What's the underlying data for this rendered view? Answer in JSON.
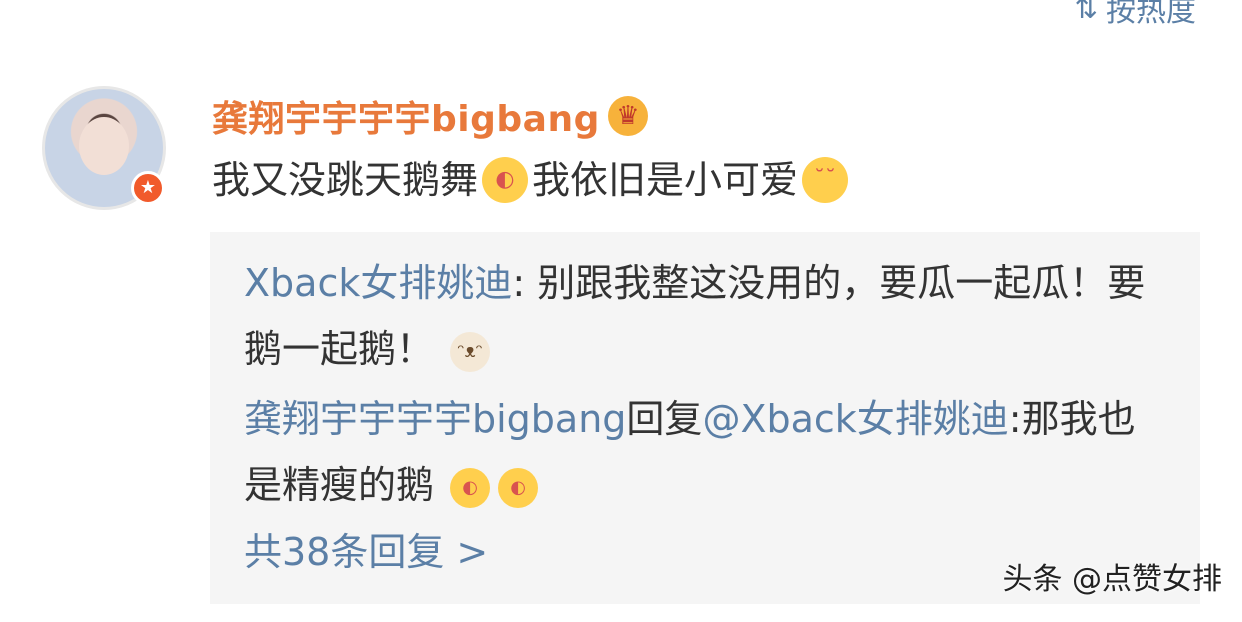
{
  "sort": {
    "label": "按热度",
    "icon": "sort-icon"
  },
  "comment": {
    "username": "龚翔宇宇宇宇bigbang",
    "crown_icon": "crown-icon",
    "text_part1": "我又没跳天鹅舞",
    "text_part2": "我依旧是小可爱",
    "emoji1": "watermelon-emoji",
    "emoji2": "blush-emoji"
  },
  "replies": [
    {
      "author": "Xback女排姚迪",
      "text": ": 别跟我整这没用的，要瓜一起瓜！要鹅一起鹅！",
      "emoji": "cat-emoji"
    },
    {
      "author": "龚翔宇宇宇宇bigbang",
      "reply_word": "回复",
      "mention": "@Xback女排姚迪",
      "text": ":那我也是精瘦的鹅",
      "emojis": [
        "watermelon-emoji",
        "watermelon-emoji"
      ]
    }
  ],
  "more_replies": "共38条回复 >",
  "watermark": "头条 @点赞女排"
}
